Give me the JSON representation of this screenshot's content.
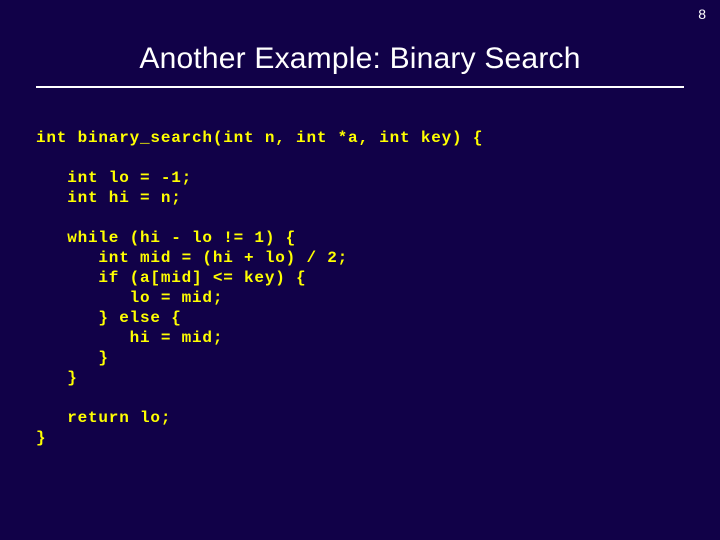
{
  "slide": {
    "page_number": "8",
    "title": "Another Example: Binary Search"
  },
  "code": {
    "l0": "int binary_search(int n, int *a, int key) {",
    "l1": "",
    "l2": "   int lo = -1;",
    "l3": "   int hi = n;",
    "l4": "",
    "l5": "   while (hi - lo != 1) {",
    "l6": "      int mid = (hi + lo) / 2;",
    "l7": "      if (a[mid] <= key) {",
    "l8": "         lo = mid;",
    "l9": "      } else {",
    "l10": "         hi = mid;",
    "l11": "      }",
    "l12": "   }",
    "l13": "",
    "l14": "   return lo;",
    "l15": "}"
  }
}
